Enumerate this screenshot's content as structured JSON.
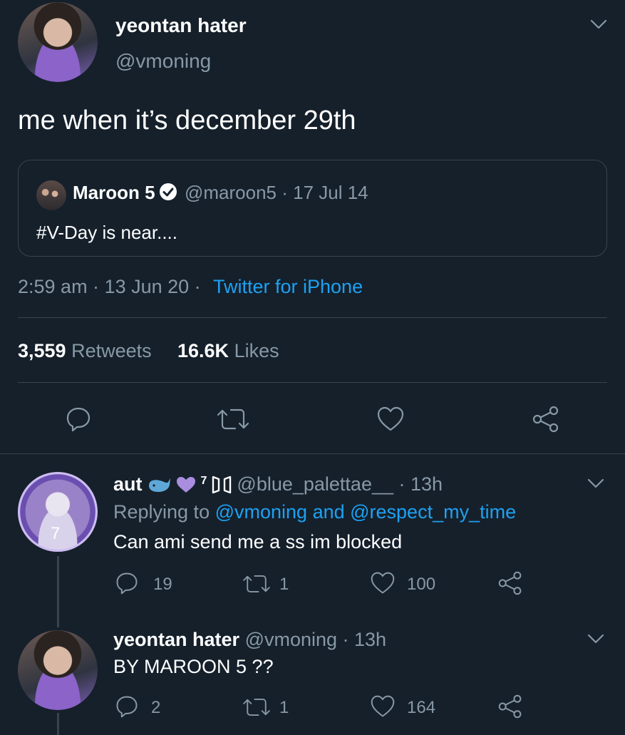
{
  "tweet": {
    "display_name": "yeontan hater",
    "handle": "@vmoning",
    "text": "me when it’s december 29th",
    "quoted": {
      "display_name": "Maroon 5",
      "handle_date": "@maroon5 · 17 Jul 14",
      "text": "#V-Day is near...."
    },
    "time_date": "2:59 am · 13 Jun 20 ·",
    "source": "Twitter for iPhone",
    "retweet_count": "3,559",
    "retweet_label": "Retweets",
    "like_count": "16.6K",
    "like_label": "Likes"
  },
  "replies": [
    {
      "display_name": "aut",
      "badge": "7",
      "meta": "@blue_palettae__ · 13h",
      "replying_prefix": "Replying to",
      "replying_to": "@vmoning and @respect_my_time",
      "text": "Can ami send me a ss im blocked",
      "replies": "19",
      "retweets": "1",
      "likes": "100"
    },
    {
      "display_name": "yeontan hater",
      "meta": "@vmoning · 13h",
      "text": "BY MAROON 5 ??",
      "replies": "2",
      "retweets": "1",
      "likes": "164"
    }
  ],
  "colors": {
    "background": "#15202b",
    "accent": "#1da1f2",
    "muted": "#8899a6",
    "verified": "#ffffff"
  }
}
